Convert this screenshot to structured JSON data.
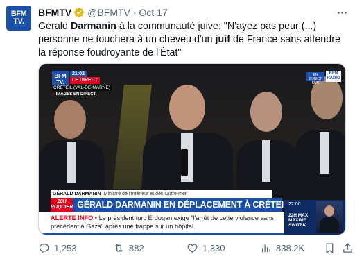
{
  "tweet": {
    "avatar": {
      "line1": "BFM",
      "line2": "TV."
    },
    "author_name": "BFMTV",
    "handle": "@BFMTV",
    "separator": "·",
    "date": "Oct 17",
    "more_icon": "more-icon",
    "text_parts": [
      {
        "t": "Gérald ",
        "bold": false
      },
      {
        "t": "Darmanin",
        "bold": true
      },
      {
        "t": " à la communauté juive: \"N'ayez pas peur (...) personne ne touchera à un cheveu d'un ",
        "bold": false
      },
      {
        "t": "juif",
        "bold": true
      },
      {
        "t": " de France sans attendre la réponse foudroyante de l'État\"",
        "bold": false
      }
    ]
  },
  "video": {
    "logo": {
      "line1": "BFM",
      "line2": "TV."
    },
    "time": "21:02",
    "live_label": "LE DIRECT",
    "location": "CRÉTEIL (VAL-DE-MARNE)",
    "images_label": "IMAGES EN DIRECT",
    "radio_badge": "EN DIRECT SUR",
    "radio_logo": {
      "line1": "BFM",
      "line2": "RADIO"
    },
    "caption_name": "GÉRALD DARMANIN",
    "caption_role": "Ministre de l'Intérieur et des Outre-mer",
    "badge_20h": {
      "line1": "20H",
      "line2": "RUQUIER"
    },
    "headline": "GÉRALD DARMANIN EN DÉPLACEMENT À CRÉTEIL",
    "ticker_alert": "ALERTE INFO",
    "ticker_text": " •  Le président turc Erdogan exige \"l'arrêt de cette violence sans précédent à Gaza\" après une frappe sur un hôpital.",
    "side_time": "22.00",
    "side_program": {
      "line1": "22H MAX",
      "line2": "MAXIME",
      "line3": "SWITEK"
    }
  },
  "actions": {
    "replies": "1,253",
    "reposts": "882",
    "likes": "1,330",
    "views": "838.2K"
  },
  "colors": {
    "brand_blue": "#1b4fa8",
    "alert_red": "#e3001b",
    "verified_gold": "#e2b719",
    "muted": "#536471"
  }
}
